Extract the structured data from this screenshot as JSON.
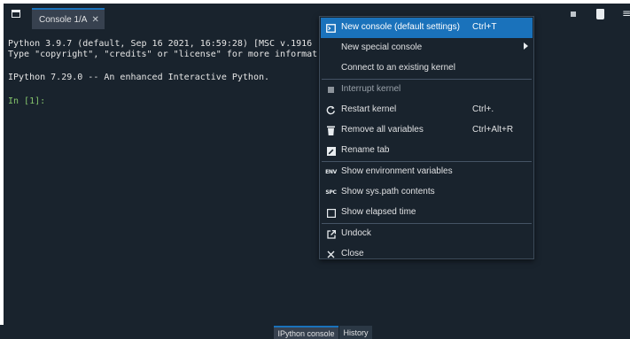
{
  "pane": {
    "tab_label": "Console 1/A",
    "tab_close": "✕"
  },
  "console": {
    "lines": [
      "Python 3.9.7 (default, Sep 16 2021, 16:59:28) [MSC v.1916",
      "Type \"copyright\", \"credits\" or \"license\" for more informat",
      "IPython 7.29.0 -- An enhanced Interactive Python."
    ],
    "prompt": "In [1]:"
  },
  "menu": {
    "items": [
      {
        "label": "New console (default settings)",
        "shortcut": "Ctrl+T",
        "icon": "new-console-icon"
      },
      {
        "label": "New special console",
        "shortcut": "",
        "icon": "none"
      },
      {
        "label": "Connect to an existing kernel",
        "shortcut": "",
        "icon": "none"
      },
      {
        "label": "Interrupt kernel",
        "shortcut": "",
        "icon": "stop-square-icon"
      },
      {
        "label": "Restart kernel",
        "shortcut": "Ctrl+.",
        "icon": "restart-icon"
      },
      {
        "label": "Remove all variables",
        "shortcut": "Ctrl+Alt+R",
        "icon": "trash-icon"
      },
      {
        "label": "Rename tab",
        "shortcut": "",
        "icon": "rename-icon"
      },
      {
        "label": "Show environment variables",
        "shortcut": "",
        "icon": "env-icon",
        "tag": "ENV"
      },
      {
        "label": "Show sys.path contents",
        "shortcut": "",
        "icon": "syspath-icon",
        "tag": "SPC"
      },
      {
        "label": "Show elapsed time",
        "shortcut": "",
        "icon": "checkbox-icon"
      },
      {
        "label": "Undock",
        "shortcut": "",
        "icon": "undock-icon"
      },
      {
        "label": "Close",
        "shortcut": "",
        "icon": "close-icon"
      }
    ]
  },
  "bottom_tabs": [
    {
      "label": "IPython console"
    },
    {
      "label": "History"
    }
  ],
  "colors": {
    "background": "#19232d",
    "accent": "#1a72bb",
    "prompt": "#85c46c"
  }
}
